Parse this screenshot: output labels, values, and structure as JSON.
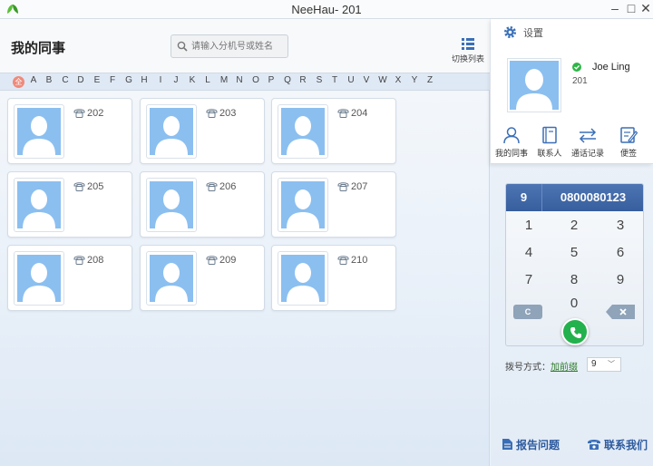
{
  "window": {
    "title": "NeeHau- 201",
    "minimize": "–",
    "maximize": "□",
    "close": "✕"
  },
  "header": {
    "title": "我的同事",
    "search_placeholder": "请输入分机号或姓名",
    "switch_view_label": "切换列表"
  },
  "alphabet": {
    "all_label": "全",
    "letters": [
      "A",
      "B",
      "C",
      "D",
      "E",
      "F",
      "G",
      "H",
      "I",
      "J",
      "K",
      "L",
      "M",
      "N",
      "O",
      "P",
      "Q",
      "R",
      "S",
      "T",
      "U",
      "V",
      "W",
      "X",
      "Y",
      "Z"
    ]
  },
  "contacts": [
    {
      "ext": "202"
    },
    {
      "ext": "203"
    },
    {
      "ext": "204"
    },
    {
      "ext": "205"
    },
    {
      "ext": "206"
    },
    {
      "ext": "207"
    },
    {
      "ext": "208"
    },
    {
      "ext": "209"
    },
    {
      "ext": "210"
    }
  ],
  "profile": {
    "settings_label": "设置",
    "name": "Joe Ling",
    "ext": "201",
    "status_color": "#2fb548"
  },
  "nav": {
    "colleagues": "我的同事",
    "contacts": "联系人",
    "call_log": "通话记录",
    "notes": "便签"
  },
  "dialpad": {
    "prefix": "9",
    "number": "0800080123",
    "keys": [
      "1",
      "2",
      "3",
      "4",
      "5",
      "6",
      "7",
      "8",
      "9"
    ],
    "zero": "0",
    "clear": "C"
  },
  "dial_mode": {
    "label": "拨号方式：",
    "link": "加前缀",
    "selected": "9"
  },
  "footer": {
    "report": "报告问题",
    "contact_us": "联系我们"
  },
  "colors": {
    "accent": "#375e9d",
    "avatar": "#8bbff0",
    "call": "#23b14d"
  }
}
